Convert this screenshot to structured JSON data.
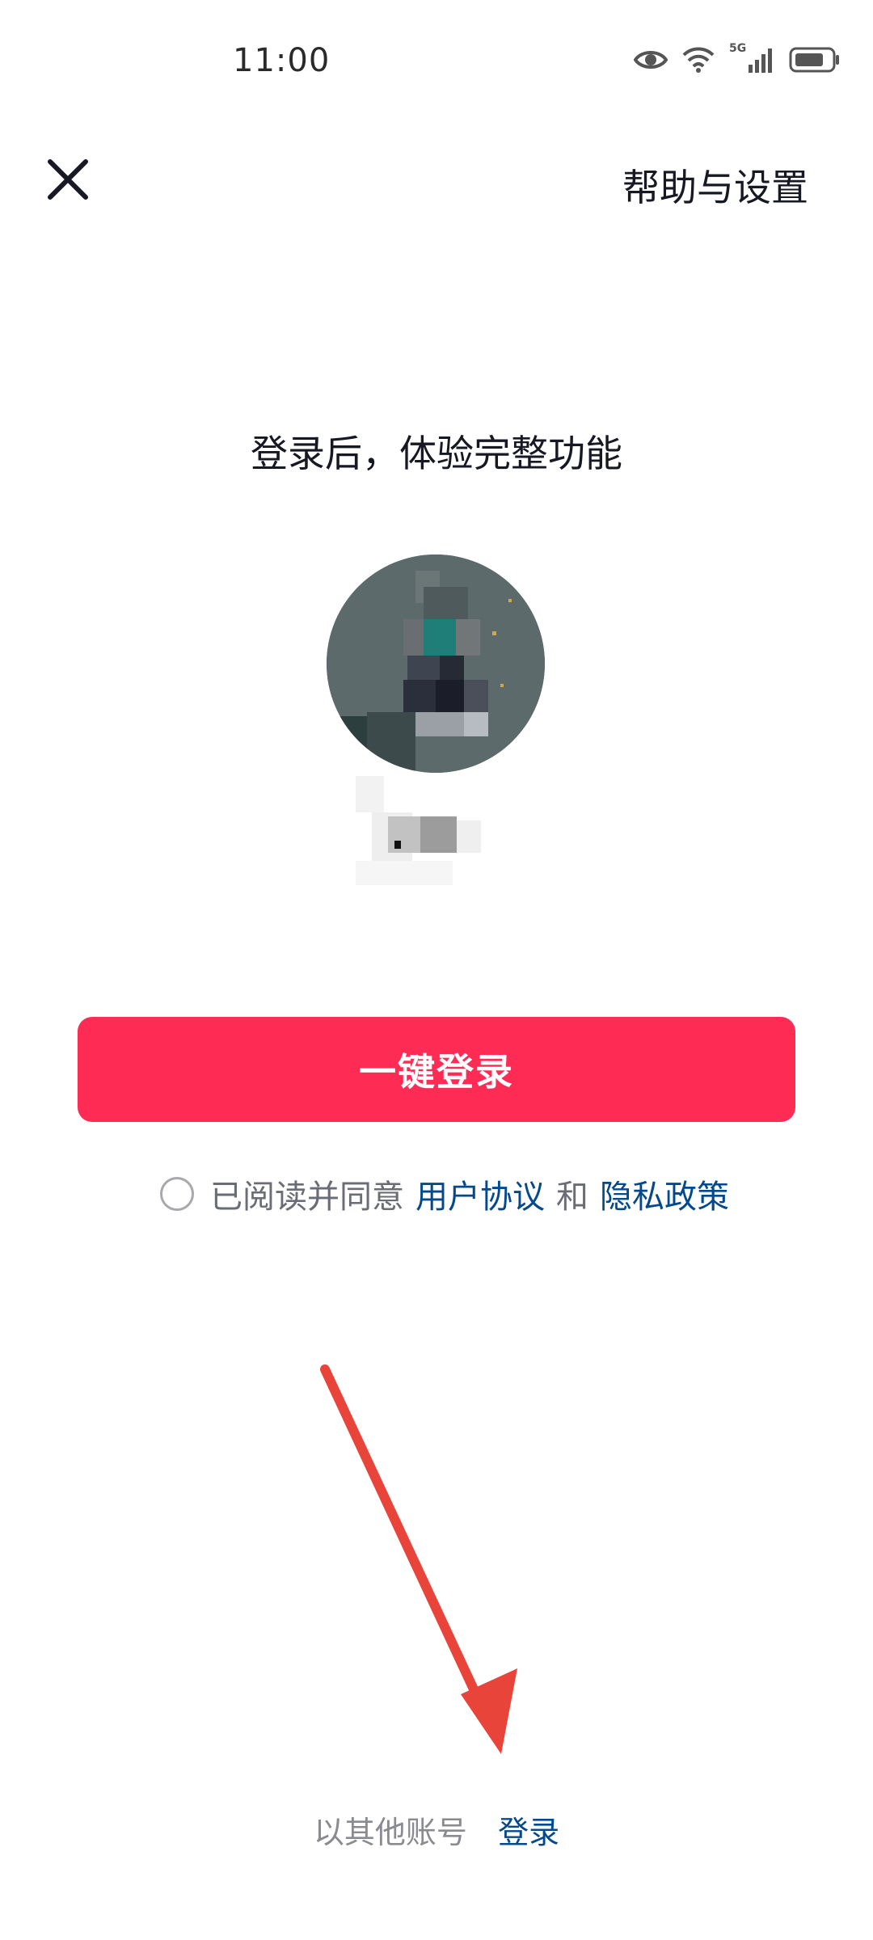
{
  "status_bar": {
    "time": "11:00",
    "icons": [
      "eye-icon",
      "wifi-icon",
      "5g-signal-icon",
      "battery-icon"
    ],
    "network_label": "5G"
  },
  "top_bar": {
    "close_icon": "close-icon",
    "help_label": "帮助与设置"
  },
  "headline": "登录后，体验完整功能",
  "account": {
    "avatar": "pixelated-avatar",
    "username": "pixelated-username"
  },
  "primary_button": {
    "label": "一键登录",
    "color": "#fe2c55"
  },
  "agreement": {
    "prefix": "已阅读并同意",
    "user_agreement": "用户协议",
    "conjunction": "和",
    "privacy_policy": "隐私政策",
    "checked": false,
    "link_color": "#04498d"
  },
  "other_login": {
    "prefix": "以其他账号",
    "link": "登录"
  },
  "annotation": {
    "arrow_color": "#e8443a"
  }
}
